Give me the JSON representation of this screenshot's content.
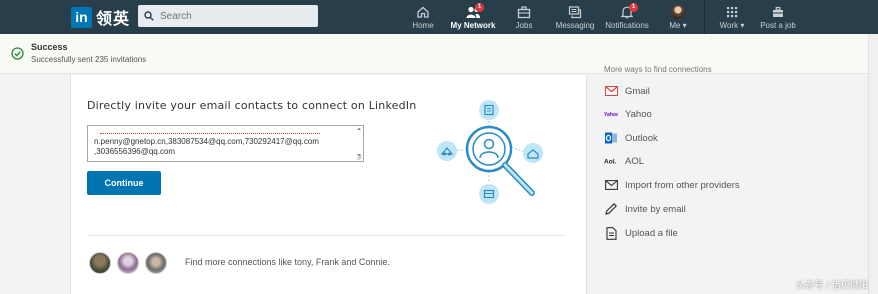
{
  "header": {
    "logo_text": "in",
    "logo_cn": "领英",
    "search_placeholder": "Search",
    "nav": [
      {
        "label": "Home",
        "icon": "home-icon",
        "badge": ""
      },
      {
        "label": "My Network",
        "icon": "network-icon",
        "badge": "1"
      },
      {
        "label": "Jobs",
        "icon": "briefcase-icon",
        "badge": ""
      },
      {
        "label": "Messaging",
        "icon": "messaging-icon",
        "badge": ""
      },
      {
        "label": "Notifications",
        "icon": "bell-icon",
        "badge": "1"
      },
      {
        "label": "Me ▾",
        "icon": "avatar",
        "badge": ""
      },
      {
        "label": "Work ▾",
        "icon": "grid-icon",
        "badge": ""
      },
      {
        "label": "Post a job",
        "icon": "post-job-icon",
        "badge": ""
      }
    ]
  },
  "notice": {
    "title": "Success",
    "message": "Successfully sent 235 invitations"
  },
  "invite": {
    "heading": "Directly invite your email contacts to connect on LinkedIn",
    "email_lines": [
      "n.penny@gnetop.cn,383087534@qq.com,730292417@qq.com",
      ",3036556396@qq.com"
    ],
    "continue_label": "Continue"
  },
  "pymk": {
    "text": "Find more connections like tony, Frank and Connie."
  },
  "sidebar": {
    "header": "More ways to find connections",
    "items": [
      {
        "label": "Gmail",
        "icon": "gmail-icon"
      },
      {
        "label": "Yahoo",
        "icon": "yahoo-icon"
      },
      {
        "label": "Outlook",
        "icon": "outlook-icon"
      },
      {
        "label": "AOL",
        "icon": "aol-icon"
      },
      {
        "label": "Import from other providers",
        "icon": "envelope-icon"
      },
      {
        "label": "Invite by email",
        "icon": "pencil-icon"
      },
      {
        "label": "Upload a file",
        "icon": "file-icon"
      }
    ]
  },
  "watermark": "头条号 / 借贝微阳",
  "colors": {
    "header_bg": "#283e4a",
    "brand_blue": "#0073b1",
    "badge_red": "#e0383e",
    "success_green": "#2e8b3a",
    "illustration_blue": "#2b8bc3"
  }
}
